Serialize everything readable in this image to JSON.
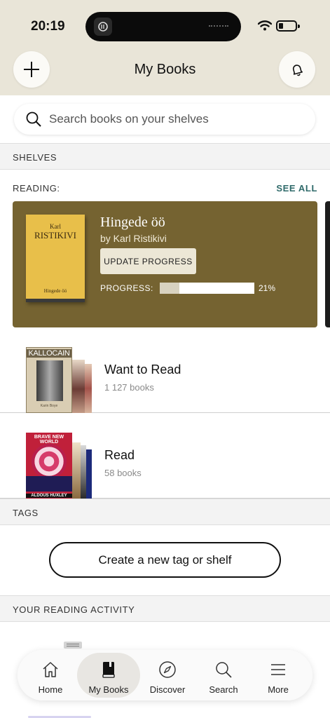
{
  "status_bar": {
    "time": "20:19"
  },
  "header": {
    "title": "My Books"
  },
  "search": {
    "placeholder": "Search books on your shelves"
  },
  "sections": {
    "shelves": "SHELVES",
    "tags": "TAGS",
    "activity": "YOUR READING ACTIVITY"
  },
  "reading": {
    "label": "READING:",
    "see_all": "SEE ALL",
    "book": {
      "title": "Hingede öö",
      "author": "by Karl Ristikivi",
      "cover_first": "Karl",
      "cover_last": "RISTIKIVI",
      "cover_title": "Hingede öö",
      "update_label": "UPDATE PROGRESS",
      "progress_label": "PROGRESS:",
      "progress_percent": 21,
      "progress_text": "21%"
    }
  },
  "shelves": [
    {
      "name": "Want to Read",
      "count": "1 127 books",
      "cover_title": "KALLOCAIN",
      "cover_foot": "Karin Boye"
    },
    {
      "name": "Read",
      "count": "58 books",
      "cover_top": "BRAVE NEW WORLD",
      "cover_foot": "ALDOUS HUXLEY"
    }
  ],
  "tags": {
    "create_label": "Create a new tag or shelf"
  },
  "tabbar": {
    "items": [
      {
        "label": "Home",
        "icon": "home-icon"
      },
      {
        "label": "My Books",
        "icon": "book-icon",
        "active": true
      },
      {
        "label": "Discover",
        "icon": "compass-icon"
      },
      {
        "label": "Search",
        "icon": "search-icon"
      },
      {
        "label": "More",
        "icon": "menu-icon"
      }
    ]
  },
  "colors": {
    "header_bg": "#e9e5d8",
    "reading_card": "#756331",
    "accent_link": "#2f6a6a"
  }
}
